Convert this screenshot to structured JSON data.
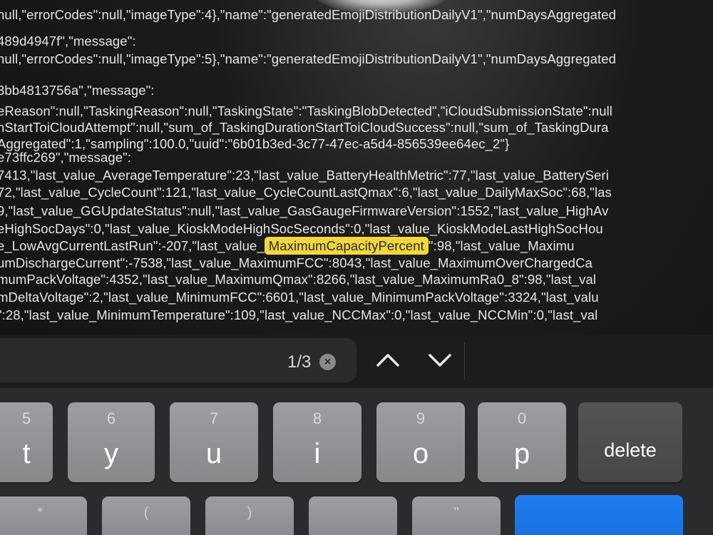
{
  "json_lines": [
    {
      "text": "null,\"errorCodes\":null,\"imageType\":4},\"name\":\"generatedEmojiDistributionDailyV1\",\"numDaysAggregated"
    },
    {
      "text": "489d4947f\",\"message\":"
    },
    {
      "text": "null,\"errorCodes\":null,\"imageType\":5},\"name\":\"generatedEmojiDistributionDailyV1\",\"numDaysAggregated"
    },
    {
      "text": "3bb4813756a\",\"message\":"
    },
    {
      "text": "eReason\":null,\"TaskingReason\":null,\"TaskingState\":\"TaskingBlobDetected\",\"iCloudSubmissionState\":null"
    },
    {
      "text": "nStartToiCloudAttempt\":null,\"sum_of_TaskingDurationStartToiCloudSuccess\":null,\"sum_of_TaskingDura"
    },
    {
      "text": "Aggregated\":1,\"sampling\":100.0,\"uuid\":\"6b01b3ed-3c77-47ec-a5d4-856539ee64ec_2\"}"
    },
    {
      "text": "e73ffc269\",\"message\":"
    },
    {
      "text": "7413,\"last_value_AverageTemperature\":23,\"last_value_BatteryHealthMetric\":77,\"last_value_BatterySeri"
    },
    {
      "text": "72,\"last_value_CycleCount\":121,\"last_value_CycleCountLastQmax\":6,\"last_value_DailyMaxSoc\":68,\"las"
    },
    {
      "text": "9,\"last_value_GGUpdateStatus\":null,\"last_value_GasGaugeFirmwareVersion\":1552,\"last_value_HighAv"
    },
    {
      "text": "eHighSocDays\":0,\"last_value_KioskModeHighSocSeconds\":0,\"last_value_KioskModeLastHighSocHou"
    },
    {
      "text": "e_LowAvgCurrentLastRun\":-207,\"last_value_",
      "highlight": "MaximumCapacityPercent",
      "after": "\":98,\"last_value_Maximu"
    },
    {
      "text": "umDischargeCurrent\":-7538,\"last_value_MaximumFCC\":8043,\"last_value_MaximumOverChargedCa"
    },
    {
      "text": "mumPackVoltage\":4352,\"last_value_MaximumQmax\":8266,\"last_value_MaximumRa0_8\":98,\"last_val"
    },
    {
      "text": "mDeltaVoltage\":2,\"last_value_MinimumFCC\":6601,\"last_value_MinimumPackVoltage\":3324,\"last_valu"
    },
    {
      "text": "\":28,\"last_value_MinimumTemperature\":109,\"last_value_NCCMax\":0,\"last_value_NCCMin\":0,\"last_val"
    }
  ],
  "find_bar": {
    "match_count": "1/3",
    "clear_icon": "×"
  },
  "keyboard": {
    "keys": [
      {
        "num": "5",
        "letter": "t"
      },
      {
        "num": "6",
        "letter": "y"
      },
      {
        "num": "7",
        "letter": "u"
      },
      {
        "num": "8",
        "letter": "i"
      },
      {
        "num": "9",
        "letter": "o"
      },
      {
        "num": "0",
        "letter": "p"
      }
    ],
    "delete_label": "delete",
    "bottom_row_symbols": [
      "*",
      "(",
      ")",
      "",
      "\""
    ]
  }
}
